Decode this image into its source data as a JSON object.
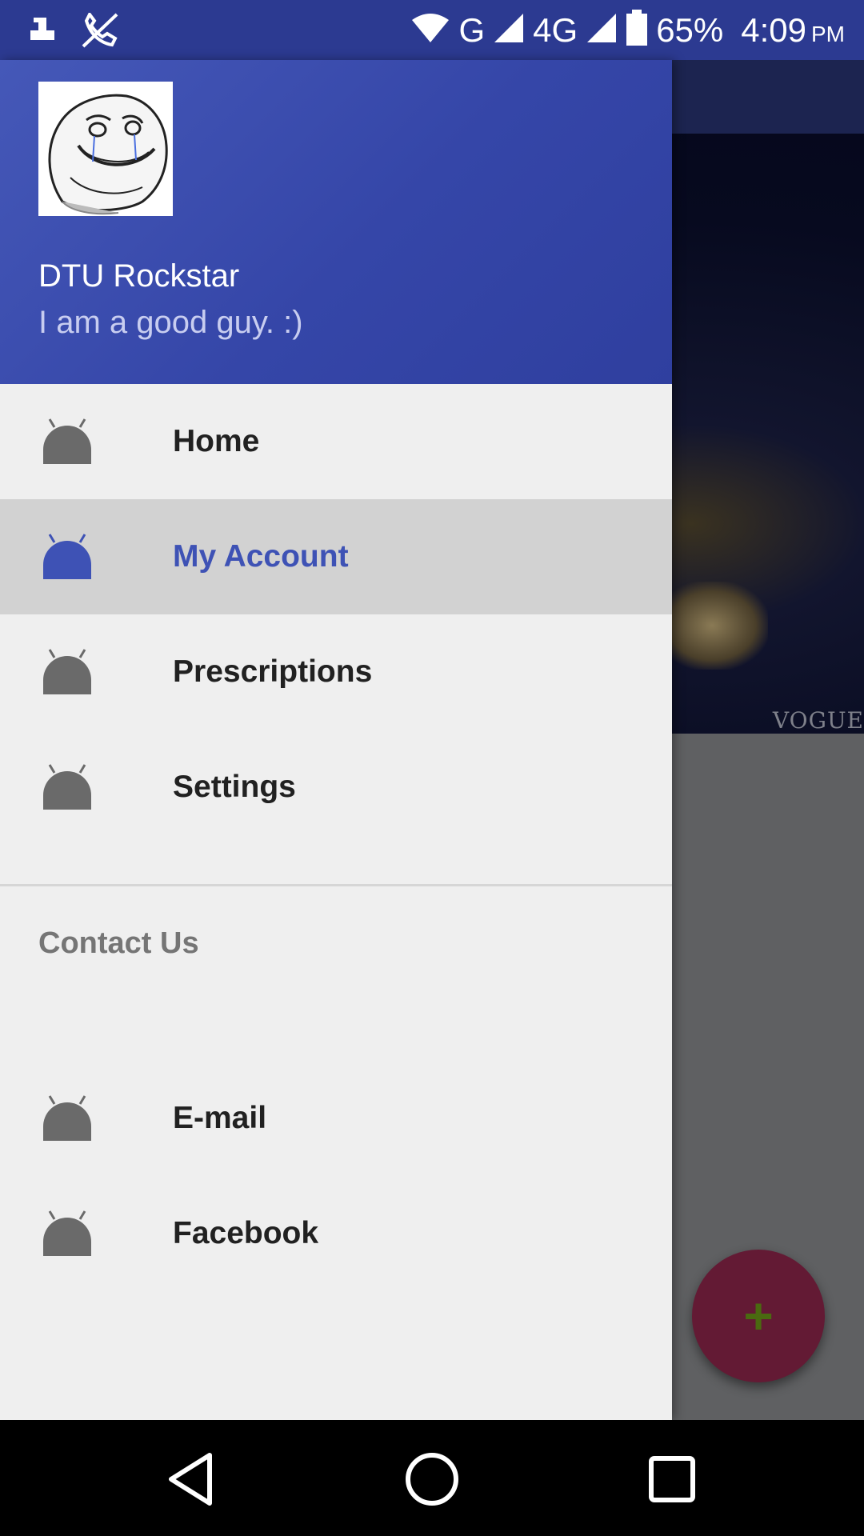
{
  "status_bar": {
    "battery": "65%",
    "time": "4:09",
    "ampm": "PM",
    "network_1": "G",
    "network_2": "4G",
    "icons": [
      "notification-icon",
      "no-call-icon",
      "wifi-icon",
      "signal-icon",
      "signal-icon",
      "battery-icon"
    ]
  },
  "user": {
    "name": "DTU Rockstar",
    "status": "I am a good guy. :)"
  },
  "menu": {
    "items": [
      {
        "label": "Home",
        "icon": "android-icon",
        "active": false
      },
      {
        "label": "My Account",
        "icon": "android-icon",
        "active": true
      },
      {
        "label": "Prescriptions",
        "icon": "android-icon",
        "active": false
      },
      {
        "label": "Settings",
        "icon": "android-icon",
        "active": false
      }
    ]
  },
  "contact": {
    "header": "Contact Us",
    "items": [
      {
        "label": "E-mail",
        "icon": "android-icon"
      },
      {
        "label": "Facebook",
        "icon": "android-icon"
      }
    ]
  },
  "background": {
    "watermark": "VOGUE"
  },
  "fab": {
    "icon": "plus-icon",
    "symbol": "+"
  },
  "colors": {
    "primary": "#3f51b5",
    "status_bar": "#2c3a91",
    "active_item_bg": "#d2d2d2",
    "active_text": "#3e52b5",
    "fab": "#631a34",
    "icon_grey": "#6a6a6a"
  }
}
